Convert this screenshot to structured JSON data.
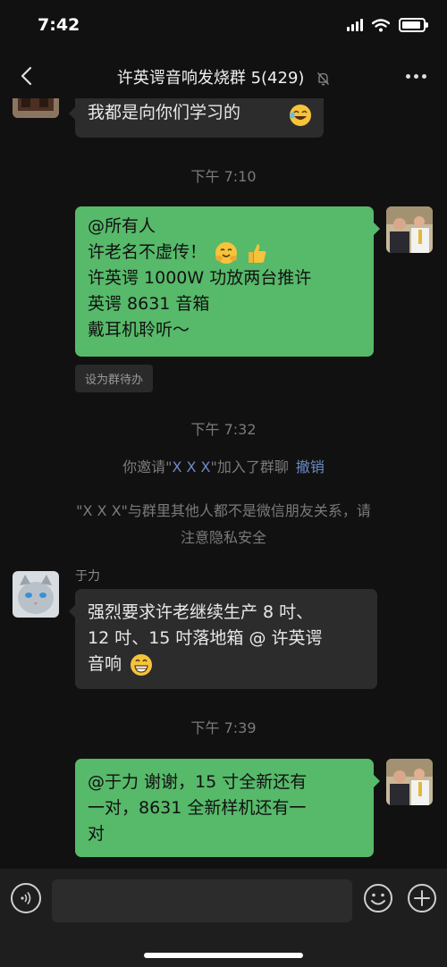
{
  "status_bar": {
    "time": "7:42"
  },
  "header": {
    "title": "许英谔音响发烧群 5(429)"
  },
  "messages": {
    "m1": {
      "lines": [
        "我都是向你们学习的"
      ]
    },
    "t1": "下午 7:10",
    "m2": {
      "lines": [
        "@所有人",
        "许老名不虚传！",
        "许英谔 1000W 功放两台推许",
        "英谔 8631 音箱",
        "戴耳机聆听～"
      ],
      "tag": "设为群待办"
    },
    "t2": "下午 7:32",
    "sys1": {
      "prefix": "你邀请\"",
      "name": "X X X",
      "suffix": "\"加入了群聊",
      "action": "撤销"
    },
    "sys2": {
      "lines": [
        "\"X X X\"与群里其他人都不是微信朋友关系，请",
        "注意隐私安全"
      ]
    },
    "m3": {
      "sender": "于力",
      "lines": [
        "强烈要求许老继续生产 8 吋、",
        "12 吋、15 吋落地箱 @ 许英谔",
        "音响"
      ]
    },
    "t3": "下午 7:39",
    "m4": {
      "lines": [
        "@于力 谢谢，15 寸全新还有",
        "一对，8631 全新样机还有一",
        "对"
      ]
    }
  },
  "input": {
    "placeholder": ""
  },
  "colors": {
    "background": "#111111",
    "bubble_in": "#2c2c2c",
    "bubble_out": "#57b96a",
    "link": "#6b8bc6",
    "meta_text": "#7a7a7a"
  },
  "icons": {
    "back": "chevron-left-icon",
    "mute": "bell-slash-icon",
    "more": "ellipsis-icon",
    "voice": "voice-icon",
    "emoji": "smiley-icon",
    "plus": "plus-icon"
  }
}
